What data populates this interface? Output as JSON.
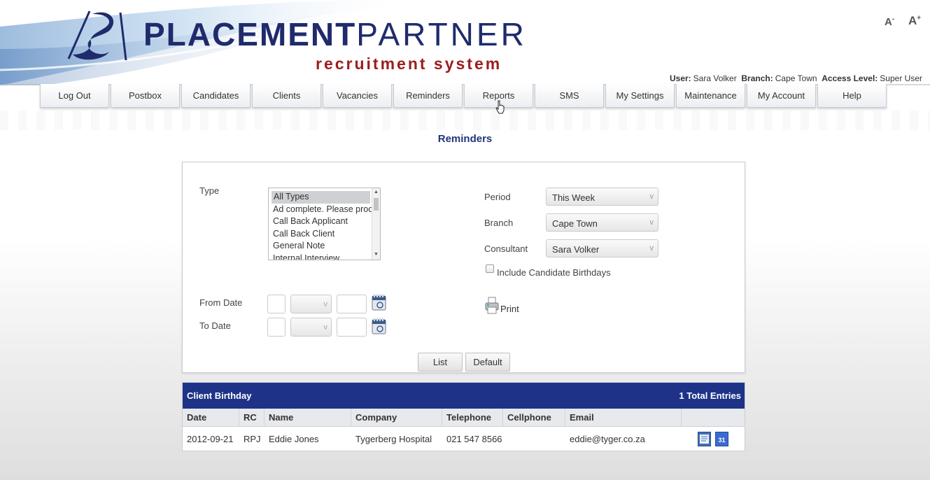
{
  "brand": {
    "name_bold": "PLACEMENT",
    "name_light": "PARTNER",
    "tagline": "recruitment system"
  },
  "font_controls": {
    "decrease_letter": "A",
    "decrease_mark": "-",
    "increase_letter": "A",
    "increase_mark": "+"
  },
  "user_bar": {
    "user_label": "User:",
    "user_value": "Sara Volker",
    "branch_label": "Branch:",
    "branch_value": "Cape Town",
    "access_label": "Access Level:",
    "access_value": "Super User"
  },
  "nav": {
    "items": [
      "Log Out",
      "Postbox",
      "Candidates",
      "Clients",
      "Vacancies",
      "Reminders",
      "Reports",
      "SMS",
      "My Settings",
      "Maintenance",
      "My Account",
      "Help"
    ]
  },
  "page": {
    "title": "Reminders"
  },
  "filters": {
    "type_label": "Type",
    "type_options": [
      "All Types",
      "Ad complete. Please proof",
      "Call Back Applicant",
      "Call Back Client",
      "General Note",
      "Internal Interview"
    ],
    "period_label": "Period",
    "period_value": "This Week",
    "branch_label": "Branch",
    "branch_value": "Cape Town",
    "consultant_label": "Consultant",
    "consultant_value": "Sara Volker",
    "birthdays_label": "Include Candidate Birthdays",
    "from_date_label": "From Date",
    "to_date_label": "To Date",
    "print_label": "Print",
    "list_button": "List",
    "default_button": "Default"
  },
  "results": {
    "title": "Client Birthday",
    "total": "1 Total Entries",
    "columns": [
      "Date",
      "RC",
      "Name",
      "Company",
      "Telephone",
      "Cellphone",
      "Email",
      ""
    ],
    "rows": [
      {
        "date": "2012-09-21",
        "rc": "RPJ",
        "name": "Eddie Jones",
        "company": "Tygerberg Hospital",
        "telephone": "021 547 8566",
        "cellphone": "",
        "email": "eddie@tyger.co.za"
      }
    ]
  },
  "colors": {
    "navy": "#1e3388",
    "brand_blue": "#1f2b6b",
    "tagline_red": "#9c1d1d"
  },
  "icons": [
    "logo-mark-icon",
    "calendar-icon",
    "printer-icon",
    "notes-icon",
    "calendar-31-icon",
    "cursor-icon"
  ]
}
